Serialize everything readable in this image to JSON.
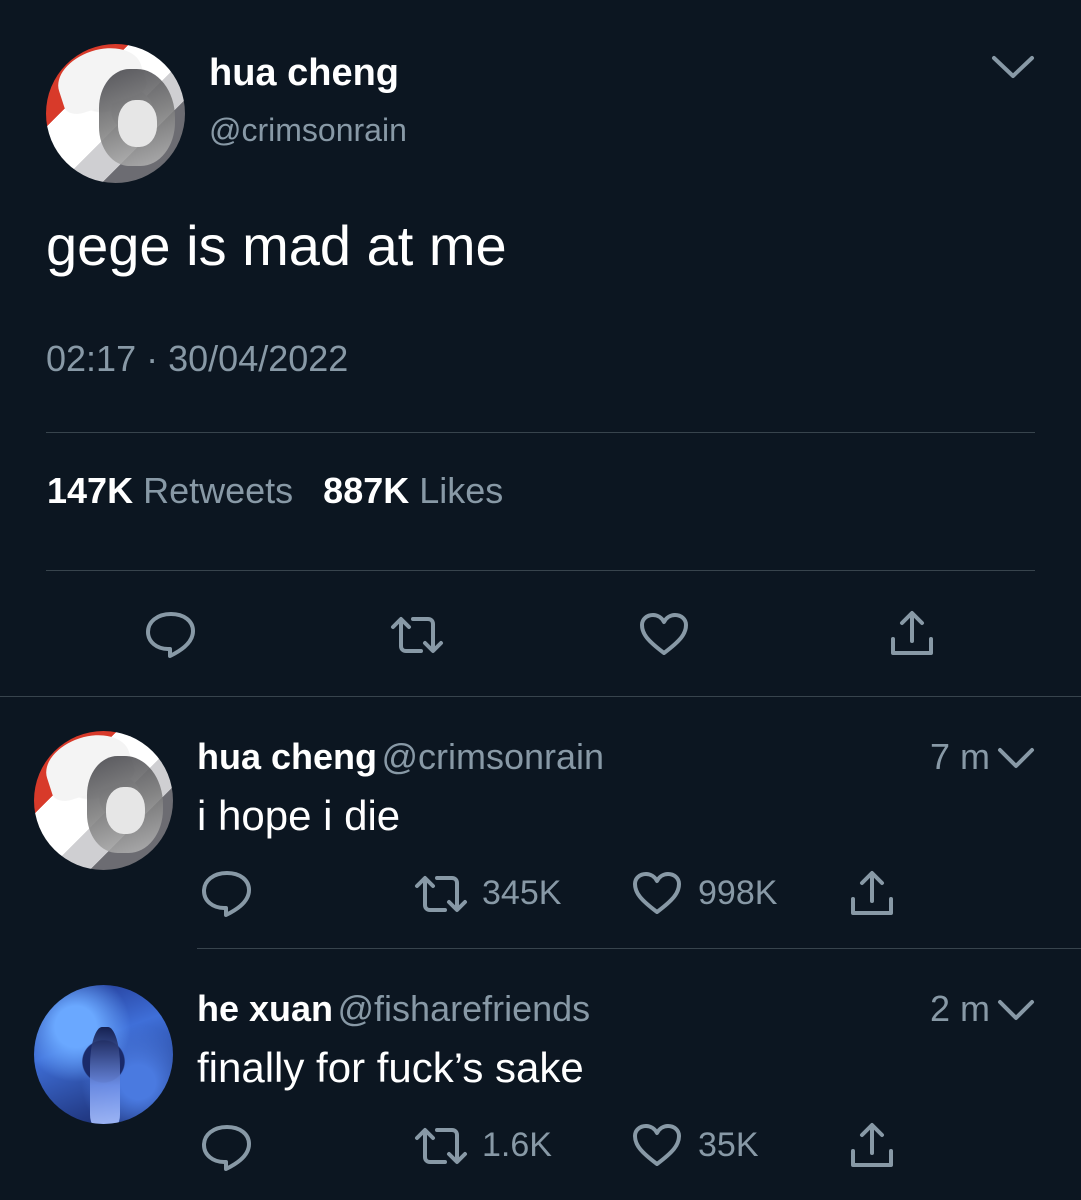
{
  "main_tweet": {
    "name": "hua cheng",
    "handle": "@crimsonrain",
    "text": "gege is mad at me",
    "time": "02:17",
    "separator": "·",
    "date": "30/04/2022",
    "retweets_count": "147K",
    "retweets_label": "Retweets",
    "likes_count": "887K",
    "likes_label": "Likes",
    "actions": [
      "reply-icon",
      "retweet-icon",
      "like-icon",
      "share-icon"
    ]
  },
  "replies": [
    {
      "name": "hua cheng",
      "handle": "@crimsonrain",
      "time": "7 m",
      "text": "i hope i die",
      "retweets": "345K",
      "likes": "998K"
    },
    {
      "name": "he xuan",
      "handle": "@fisharefriends",
      "time": "2 m",
      "text": "finally for fuck’s sake",
      "retweets": "1.6K",
      "likes": "35K"
    }
  ],
  "colors": {
    "background": "#0c1621",
    "text": "#ffffff",
    "secondary": "#8899a6",
    "divider": "#38444d"
  }
}
